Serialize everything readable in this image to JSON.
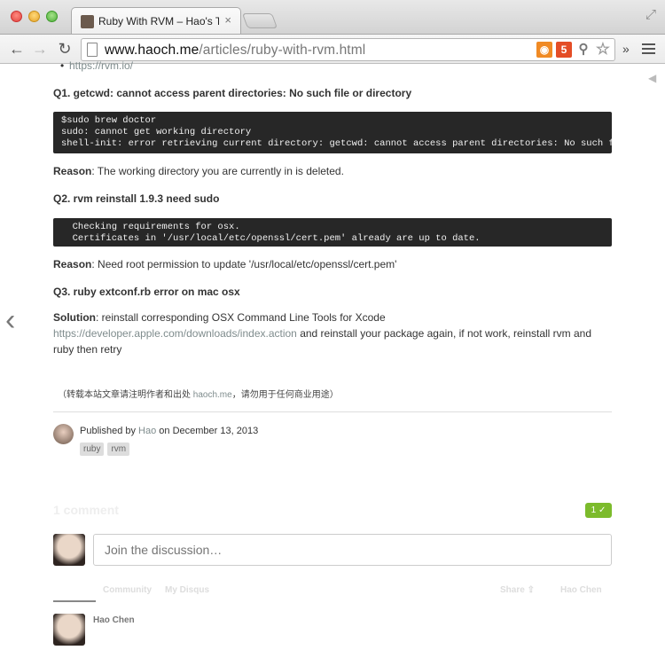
{
  "browser": {
    "tab_title": "Ruby With RVM – Hao's Th",
    "tab_close": "×",
    "url_host": "www.haoch.me",
    "url_path": "/articles/ruby-with-rvm.html",
    "back_icon": "←",
    "forward_icon": "→",
    "reload_icon": "↻",
    "extend_icon": "»"
  },
  "article": {
    "link_item": "https://rvm.io/",
    "q1": {
      "heading": "Q1. getcwd: cannot access parent directories: No such file or directory",
      "code_lines": [
        "$sudo brew doctor",
        "sudo: cannot get working directory",
        "shell-init: error retrieving current directory: getcwd: cannot access parent directories: No such file or director"
      ],
      "reason_label": "Reason",
      "reason_text": ": The working directory you are currently in is deleted."
    },
    "q2": {
      "heading": "Q2. rvm reinstall 1.9.3 need sudo",
      "code_lines": [
        "  Checking requirements for osx.",
        "  Certificates in '/usr/local/etc/openssl/cert.pem' already are up to date."
      ],
      "reason_label": "Reason",
      "reason_text": ": Need root permission to update '/usr/local/etc/openssl/cert.pem'"
    },
    "q3": {
      "heading": "Q3. ruby extconf.rb error on mac osx",
      "solution_label": "Solution",
      "solution_text": ": reinstall corresponding OSX Command Line Tools for Xcode",
      "solution_link": "https://developer.apple.com/downloads/index.action",
      "solution_rest": " and reinstall your package again, if not work, reinstall rvm and ruby then retry"
    },
    "note_prefix": "（转载本站文章请注明作者和出处 ",
    "note_link": "haoch.me",
    "note_suffix": "，请勿用于任何商业用途）"
  },
  "meta": {
    "published_by": "Published by ",
    "author": "Hao",
    "date_text": " on December 13, 2013",
    "tags": [
      "ruby",
      "rvm"
    ]
  },
  "disqus": {
    "count_text": "1 comment",
    "badge": "1 ✓",
    "join_placeholder": "Join the discussion…",
    "tab_community": "Community",
    "tab_my_disqus": "My Disqus",
    "share": "Share ⇪",
    "user": "Hao Chen",
    "commenter_name": "Hao Chen"
  }
}
